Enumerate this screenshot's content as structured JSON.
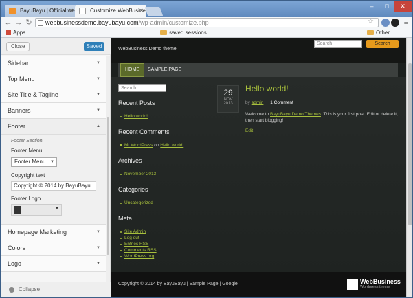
{
  "browser": {
    "tabs": [
      {
        "title": "BayuBayu | Official websi",
        "favicon_color": "#f0912a"
      },
      {
        "title": "Customize WebBusiness",
        "favicon_color": "#9e9e9e"
      }
    ],
    "url_host": "webbusinessdemo.bayubayu.com",
    "url_path": "/wp-admin/customize.php",
    "bookmarks": {
      "apps": "Apps",
      "saved": "saved sessions",
      "other": "Other bookmarks"
    }
  },
  "customizer": {
    "close_label": "Close",
    "saved_label": "Saved",
    "sections_top": [
      {
        "label": "Sidebar"
      },
      {
        "label": "Top Menu"
      },
      {
        "label": "Site Title & Tagline"
      },
      {
        "label": "Banners"
      }
    ],
    "open_section": {
      "label": "Footer",
      "description": "Footer Section.",
      "menu_label": "Footer Menu",
      "menu_value": "Footer Menu",
      "copyright_label": "Copyright text",
      "copyright_value": "Copyright © 2014 by BayuBayu",
      "logo_label": "Footer Logo"
    },
    "sections_bottom": [
      {
        "label": "Homepage Marketing"
      },
      {
        "label": "Colors"
      },
      {
        "label": "Logo"
      }
    ],
    "collapse_label": "Collapse"
  },
  "preview": {
    "tagline": "WebBusiness Demo theme",
    "search_placeholder": "Search",
    "search_button": "Search",
    "menu": [
      "HOME",
      "SAMPLE PAGE"
    ],
    "sidebar_search": "Search ...",
    "recent_posts_title": "Recent Posts",
    "recent_posts": [
      "Hello world!"
    ],
    "recent_comments_title": "Recent Comments",
    "comment_author": "Mr WordPress",
    "comment_on": "on",
    "comment_post": "Hello world!",
    "archives_title": "Archives",
    "archives": [
      "November 2013"
    ],
    "categories_title": "Categories",
    "categories": [
      "Uncategorized"
    ],
    "meta_title": "Meta",
    "meta_links": [
      "Site Admin",
      "Log out",
      "Entries RSS",
      "Comments RSS",
      "WordPress.org"
    ],
    "post": {
      "day": "29",
      "month": "NOV",
      "year": "2013",
      "title": "Hello world!",
      "by": "by",
      "author": "admin",
      "comments": "1 Comment",
      "body_1": "Welcome to",
      "body_link": "BayuBayu Demo Themes",
      "body_2": ". This is your first post. Edit or delete it, then start blogging!",
      "edit": "Edit"
    },
    "footer_text": "Copyright © 2014 by BayuBayu   |   Sample Page   |   Google",
    "footer_logo_name": "WebBusiness",
    "footer_logo_sub": "Wordpress theme"
  }
}
